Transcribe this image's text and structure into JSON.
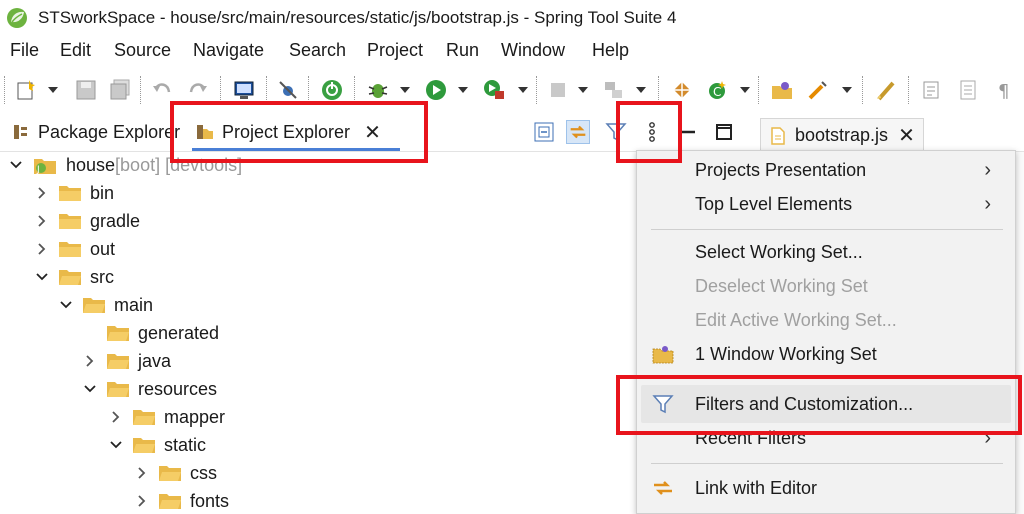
{
  "window": {
    "title": "STSworkSpace - house/src/main/resources/static/js/bootstrap.js - Spring Tool Suite 4",
    "icon": "spring-leaf-icon"
  },
  "menu": [
    {
      "label": "File"
    },
    {
      "label": "Edit"
    },
    {
      "label": "Source"
    },
    {
      "label": "Navigate"
    },
    {
      "label": "Search"
    },
    {
      "label": "Project"
    },
    {
      "label": "Run"
    },
    {
      "label": "Window"
    },
    {
      "label": "Help"
    }
  ],
  "tabs": {
    "package_explorer": "Package Explorer",
    "project_explorer": "Project Explorer",
    "project_explorer_close": "✕",
    "editor_tab": "bootstrap.js",
    "editor_close": "✕"
  },
  "tree": [
    {
      "label": "house",
      "decoration": " [boot] [devtools]",
      "expanded": true,
      "type": "project"
    },
    {
      "label": "bin",
      "expanded": false,
      "type": "folder"
    },
    {
      "label": "gradle",
      "expanded": false,
      "type": "folder"
    },
    {
      "label": "out",
      "expanded": false,
      "type": "folder"
    },
    {
      "label": "src",
      "expanded": true,
      "type": "folder"
    },
    {
      "label": "main",
      "expanded": true,
      "type": "folder"
    },
    {
      "label": "generated",
      "expanded": null,
      "type": "folder"
    },
    {
      "label": "java",
      "expanded": false,
      "type": "folder"
    },
    {
      "label": "resources",
      "expanded": true,
      "type": "folder"
    },
    {
      "label": "mapper",
      "expanded": false,
      "type": "folder"
    },
    {
      "label": "static",
      "expanded": true,
      "type": "folder"
    },
    {
      "label": "css",
      "expanded": false,
      "type": "folder"
    },
    {
      "label": "fonts",
      "expanded": false,
      "type": "folder"
    }
  ],
  "view_menu": {
    "items": [
      {
        "label": "Projects Presentation",
        "submenu": true,
        "enabled": true
      },
      {
        "label": "Top Level Elements",
        "submenu": true,
        "enabled": true
      },
      {
        "label": "Select Working Set...",
        "submenu": false,
        "enabled": true
      },
      {
        "label": "Deselect Working Set",
        "submenu": false,
        "enabled": false
      },
      {
        "label": "Edit Active Working Set...",
        "submenu": false,
        "enabled": false
      },
      {
        "label": "1 Window Working Set",
        "submenu": false,
        "enabled": true,
        "icon": "working-set-icon"
      },
      {
        "label": "Filters and Customization...",
        "submenu": false,
        "enabled": true,
        "icon": "filter-icon",
        "hovered": true
      },
      {
        "label": "Recent Filters",
        "submenu": true,
        "enabled": true
      },
      {
        "label": "Link with Editor",
        "submenu": false,
        "enabled": true,
        "icon": "link-with-editor-icon"
      }
    ],
    "submenu_arrow": "›"
  },
  "colors": {
    "highlight_box": "#e8141c",
    "active_tab_underline": "#4a7fd6",
    "folder": "#e9b949",
    "decoration_text": "#999999"
  }
}
